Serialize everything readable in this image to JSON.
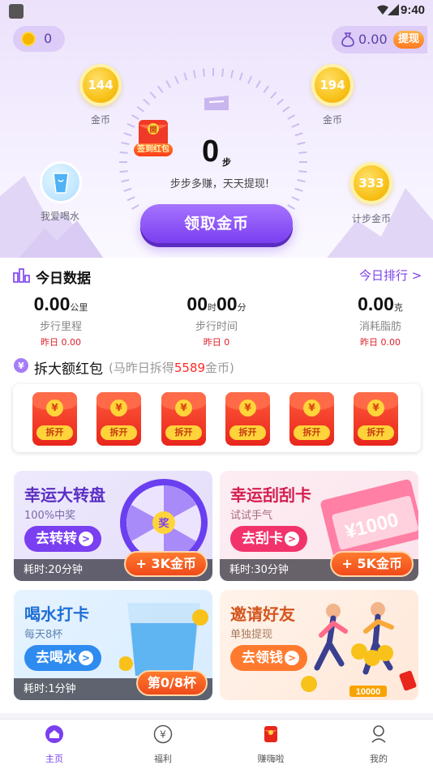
{
  "status_bar": {
    "time": "9:40"
  },
  "header": {
    "coin_count": "0",
    "cash_amount": "0.00",
    "withdraw_label": "提现"
  },
  "bubbles": [
    {
      "value": "144",
      "label": "金币"
    },
    {
      "value": "194",
      "label": "金币"
    },
    {
      "value": "333",
      "label": "计步金币"
    }
  ],
  "water": {
    "label": "我爱喝水"
  },
  "sign_packet": {
    "label": "签到红包",
    "glyph": "開"
  },
  "steps": {
    "value": "0",
    "unit": "步",
    "slogan": "步步多赚，天天提现!"
  },
  "collect_button": "领取金币",
  "today": {
    "title": "今日数据",
    "rank_link": "今日排行 >",
    "stats": [
      {
        "value": "0.00",
        "unit": "公里",
        "label": "步行里程",
        "yesterday": "昨日 0.00"
      },
      {
        "value_h": "00",
        "unit_h": "时",
        "value_m": "00",
        "unit_m": "分",
        "label": "步行时间",
        "yesterday": "昨日 0"
      },
      {
        "value": "0.00",
        "unit": "克",
        "label": "消耗脂肪",
        "yesterday": "昨日 0.00"
      }
    ]
  },
  "red_packets": {
    "title": "拆大额红包",
    "sub_prefix": "(马昨日拆得",
    "sub_amount": "5589",
    "sub_suffix": "金币)",
    "items": [
      {
        "yen": "¥",
        "label": "拆开"
      },
      {
        "yen": "¥",
        "label": "拆开"
      },
      {
        "yen": "¥",
        "label": "拆开"
      },
      {
        "yen": "¥",
        "label": "拆开"
      },
      {
        "yen": "¥",
        "label": "拆开"
      },
      {
        "yen": "¥",
        "label": "拆开"
      }
    ]
  },
  "cards": {
    "wheel": {
      "title": "幸运大转盘",
      "sub": "100%中奖",
      "button": "去转转",
      "footer": "耗时:20分钟",
      "badge": "+ 3K金币",
      "prize": "奖"
    },
    "scratch": {
      "title": "幸运刮刮卡",
      "sub": "试试手气",
      "button": "去刮卡",
      "footer": "耗时:30分钟",
      "badge": "+ 5K金币",
      "ticket_amount": "¥1000"
    },
    "water": {
      "title": "喝水打卡",
      "sub": "每天8杯",
      "button": "去喝水",
      "footer": "耗时:1分钟",
      "badge": "第0/8杯"
    },
    "invite": {
      "title": "邀请好友",
      "sub": "单独提现",
      "button": "去领钱",
      "coins": "10000"
    }
  },
  "bottom_nav": [
    {
      "label": "主页",
      "icon": "home-icon",
      "active": true
    },
    {
      "label": "福利",
      "icon": "yen-circle-icon",
      "active": false
    },
    {
      "label": "赚嗨啦",
      "icon": "red-envelope-icon",
      "active": false
    },
    {
      "label": "我的",
      "icon": "user-icon",
      "active": false
    }
  ],
  "colors": {
    "accent": "#7a3ff0",
    "red": "#e8261c",
    "gold": "#f8c21a",
    "orange": "#ff7a2e"
  }
}
